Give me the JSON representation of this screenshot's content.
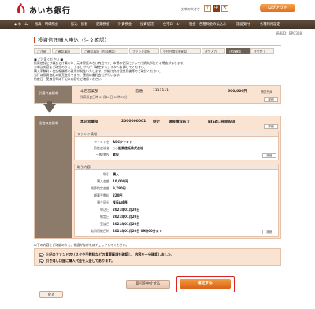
{
  "header": {
    "logo_text": "あいち銀行",
    "font_size_label": "文字の大きさ",
    "font_sizes": [
      "小",
      "中",
      "大"
    ],
    "logout_label": "ログアウト"
  },
  "nav": {
    "items": [
      "ホーム",
      "残高・明細照会",
      "振込・振替",
      "定期預金",
      "外貨預金",
      "投資信託",
      "住宅ローン",
      "税金・各種料金の払込み",
      "諸届受付",
      "各種利用設定"
    ]
  },
  "screen_id": "画面ID：BPO308",
  "page_title": "投資信託購入申込（注文確認）",
  "steps": [
    "ご注意",
    "ご確認事項",
    "ご確認事項（内容確認）",
    "ファンド選択",
    "交付目論見書確認",
    "注文入力",
    "注文確認",
    "注文完了"
  ],
  "notice": {
    "lines": [
      "■ ご注意ください ■",
      "投資信託とは預金とは異なり、元本保証のない商品です。市場の状況によっては損失が生じる場合があります。",
      "お申込内容をご確認のうえ、よろしければ「確定する」ボタンを押してください。",
      "購入手数料・信託報酬等の費用が発生いたします。詳細は交付目論見書等でご確認ください。",
      "当行は投資信託の販売会社であり、運用は委託会社が行います。",
      "約定日・受渡日等は下記の内容をご確認ください。"
    ]
  },
  "from_account": {
    "label": "引落口座情報",
    "branch": "本店営業部",
    "type": "普通",
    "number": "1111111",
    "amount": "500,000円",
    "amount_note": "預金残高",
    "sub": "残高照会日時 01月20日 09時30分",
    "detail_label": "詳細"
  },
  "to_account": {
    "label": "投信口座情報",
    "branch": "本店営業部",
    "number": "2000000001",
    "tokutei": "特定",
    "withholding": "源泉徴収あり",
    "nisa": "NISA口座開設済",
    "detail_label": "詳細"
  },
  "fund": {
    "heading": "ファンド情報",
    "rows": [
      {
        "key": "ファンド名",
        "value": "ABCファンド"
      },
      {
        "key": "投信会社名",
        "value": "○○投資信託株式会社"
      },
      {
        "key": "一般/累投",
        "value": "累投"
      }
    ],
    "detail_label": "詳細"
  },
  "trade": {
    "heading": "取引内容",
    "rows": [
      {
        "key": "取引",
        "value": "購入"
      },
      {
        "key": "購入金額",
        "value": "10,000円"
      },
      {
        "key": "概算約定金額",
        "value": "9,780円"
      },
      {
        "key": "概算手数料",
        "value": "220円"
      },
      {
        "key": "預り区分",
        "value": "NISA成長"
      },
      {
        "key": "申込日",
        "value": "2021年01月20日"
      },
      {
        "key": "約定日",
        "value": "2021年01月20日"
      },
      {
        "key": "受渡日",
        "value": "2021年01月20日"
      },
      {
        "key": "取消可能日時",
        "value": "2021年01月20日 09時00分まで"
      }
    ],
    "detail_label": "詳細"
  },
  "confirm": {
    "note": "以下の内容をご確認のうえ、相違がなければチェックしてください。",
    "check1": "上記のファンドのリスクや手数料などの重要事項を確認し、内容を十分確認しました。",
    "check2": "引き落し口座に購入代金を入金してあります。"
  },
  "actions": {
    "cancel_label": "取引を中止する",
    "submit_label": "確定する",
    "back_label": "戻る"
  },
  "colors": {
    "accent": "#d9631a",
    "nav_bg": "#4f3f32",
    "panel_bg": "#fbe3d2",
    "label_bg": "#8c7b6b"
  }
}
